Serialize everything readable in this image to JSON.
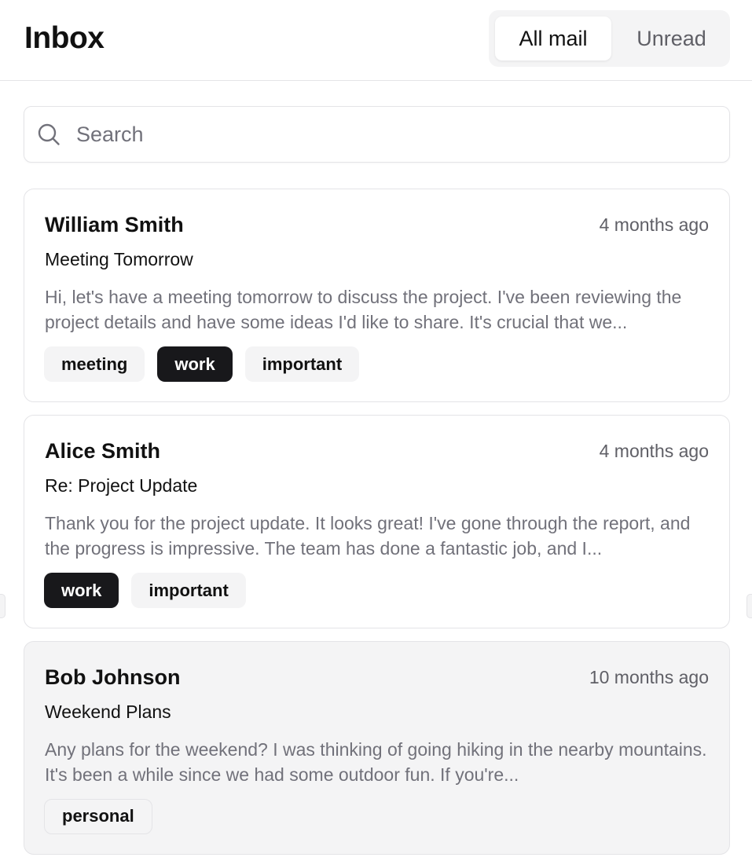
{
  "header": {
    "title": "Inbox",
    "tabs": [
      {
        "label": "All mail",
        "active": true
      },
      {
        "label": "Unread",
        "active": false
      }
    ]
  },
  "search": {
    "placeholder": "Search",
    "value": "",
    "icon": "search-icon"
  },
  "mails": [
    {
      "sender": "William Smith",
      "time": "4 months ago",
      "subject": "Meeting Tomorrow",
      "preview": "Hi, let's have a meeting tomorrow to discuss the project. I've been reviewing the project details and have some ideas I'd like to share. It's crucial that we...",
      "tags": [
        "meeting",
        "work",
        "important"
      ],
      "selected": false
    },
    {
      "sender": "Alice Smith",
      "time": "4 months ago",
      "subject": "Re: Project Update",
      "preview": "Thank you for the project update. It looks great! I've gone through the report, and the progress is impressive. The team has done a fantastic job, and I...",
      "tags": [
        "work",
        "important"
      ],
      "selected": false
    },
    {
      "sender": "Bob Johnson",
      "time": "10 months ago",
      "subject": "Weekend Plans",
      "preview": "Any plans for the weekend? I was thinking of going hiking in the nearby mountains. It's been a while since we had some outdoor fun. If you're...",
      "tags": [
        "personal"
      ],
      "selected": true
    }
  ],
  "colors": {
    "accent_dark": "#18181b",
    "muted_text": "#71717a",
    "border": "#e4e4e7",
    "selected_bg": "#f4f4f5"
  }
}
